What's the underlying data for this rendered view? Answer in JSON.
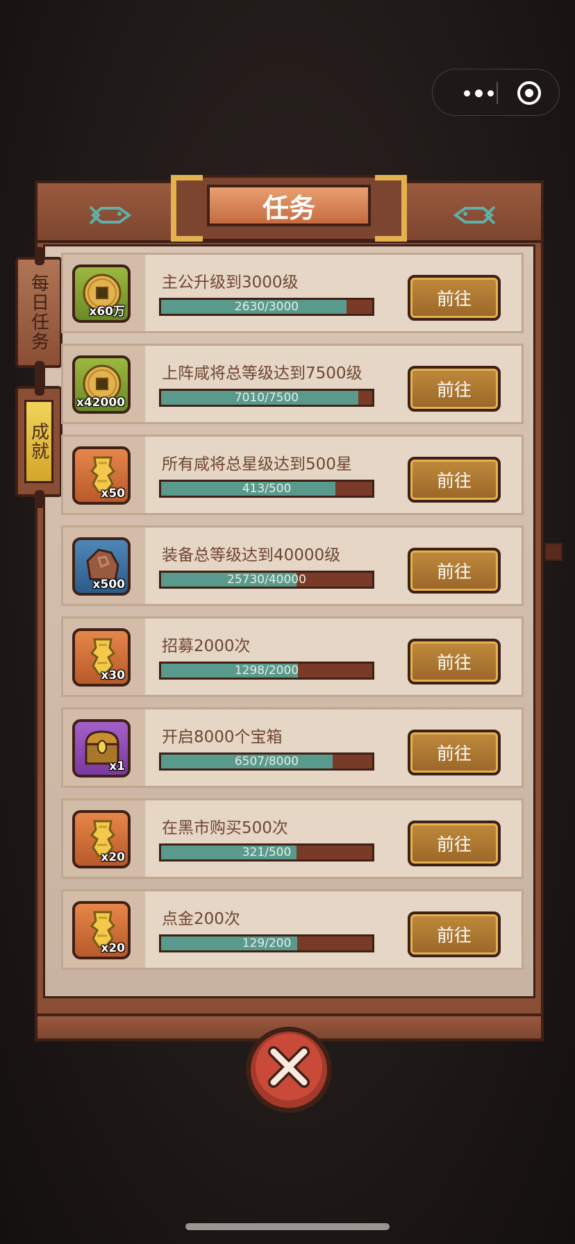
{
  "title": "任务",
  "tabs": [
    {
      "label": "每日任务",
      "active": false
    },
    {
      "label": "成就",
      "active": true
    }
  ],
  "go_label": "前往",
  "tasks": [
    {
      "title": "主公升级到3000级",
      "progress_text": "2630/3000",
      "progress": 0.877,
      "reward": {
        "icon": "coin-icon",
        "qty": "x60万",
        "bg": "green"
      }
    },
    {
      "title": "上阵咸将总等级达到7500级",
      "progress_text": "7010/7500",
      "progress": 0.935,
      "reward": {
        "icon": "coin-icon",
        "qty": "x42000",
        "bg": "green"
      }
    },
    {
      "title": "所有咸将总星级达到500星",
      "progress_text": "413/500",
      "progress": 0.826,
      "reward": {
        "icon": "gold-scroll-icon",
        "qty": "x50",
        "bg": "orange"
      }
    },
    {
      "title": "装备总等级达到40000级",
      "progress_text": "25730/40000",
      "progress": 0.643,
      "reward": {
        "icon": "stone-icon",
        "qty": "x500",
        "bg": "blue"
      }
    },
    {
      "title": "招募2000次",
      "progress_text": "1298/2000",
      "progress": 0.649,
      "reward": {
        "icon": "gold-scroll-icon",
        "qty": "x30",
        "bg": "orange"
      }
    },
    {
      "title": "开启8000个宝箱",
      "progress_text": "6507/8000",
      "progress": 0.813,
      "reward": {
        "icon": "treasure-chest-icon",
        "qty": "x1",
        "bg": "purple"
      }
    },
    {
      "title": "在黑市购买500次",
      "progress_text": "321/500",
      "progress": 0.642,
      "reward": {
        "icon": "gold-scroll-icon",
        "qty": "x20",
        "bg": "orange"
      }
    },
    {
      "title": "点金200次",
      "progress_text": "129/200",
      "progress": 0.645,
      "reward": {
        "icon": "gold-scroll-icon",
        "qty": "x20",
        "bg": "orange"
      }
    }
  ],
  "colors": {
    "progress_fill": "#5a9a8c",
    "progress_track": "#7a3a28",
    "wood": "#8a4e35",
    "button_gold": "#c08a3c",
    "close_red": "#c94a38"
  }
}
